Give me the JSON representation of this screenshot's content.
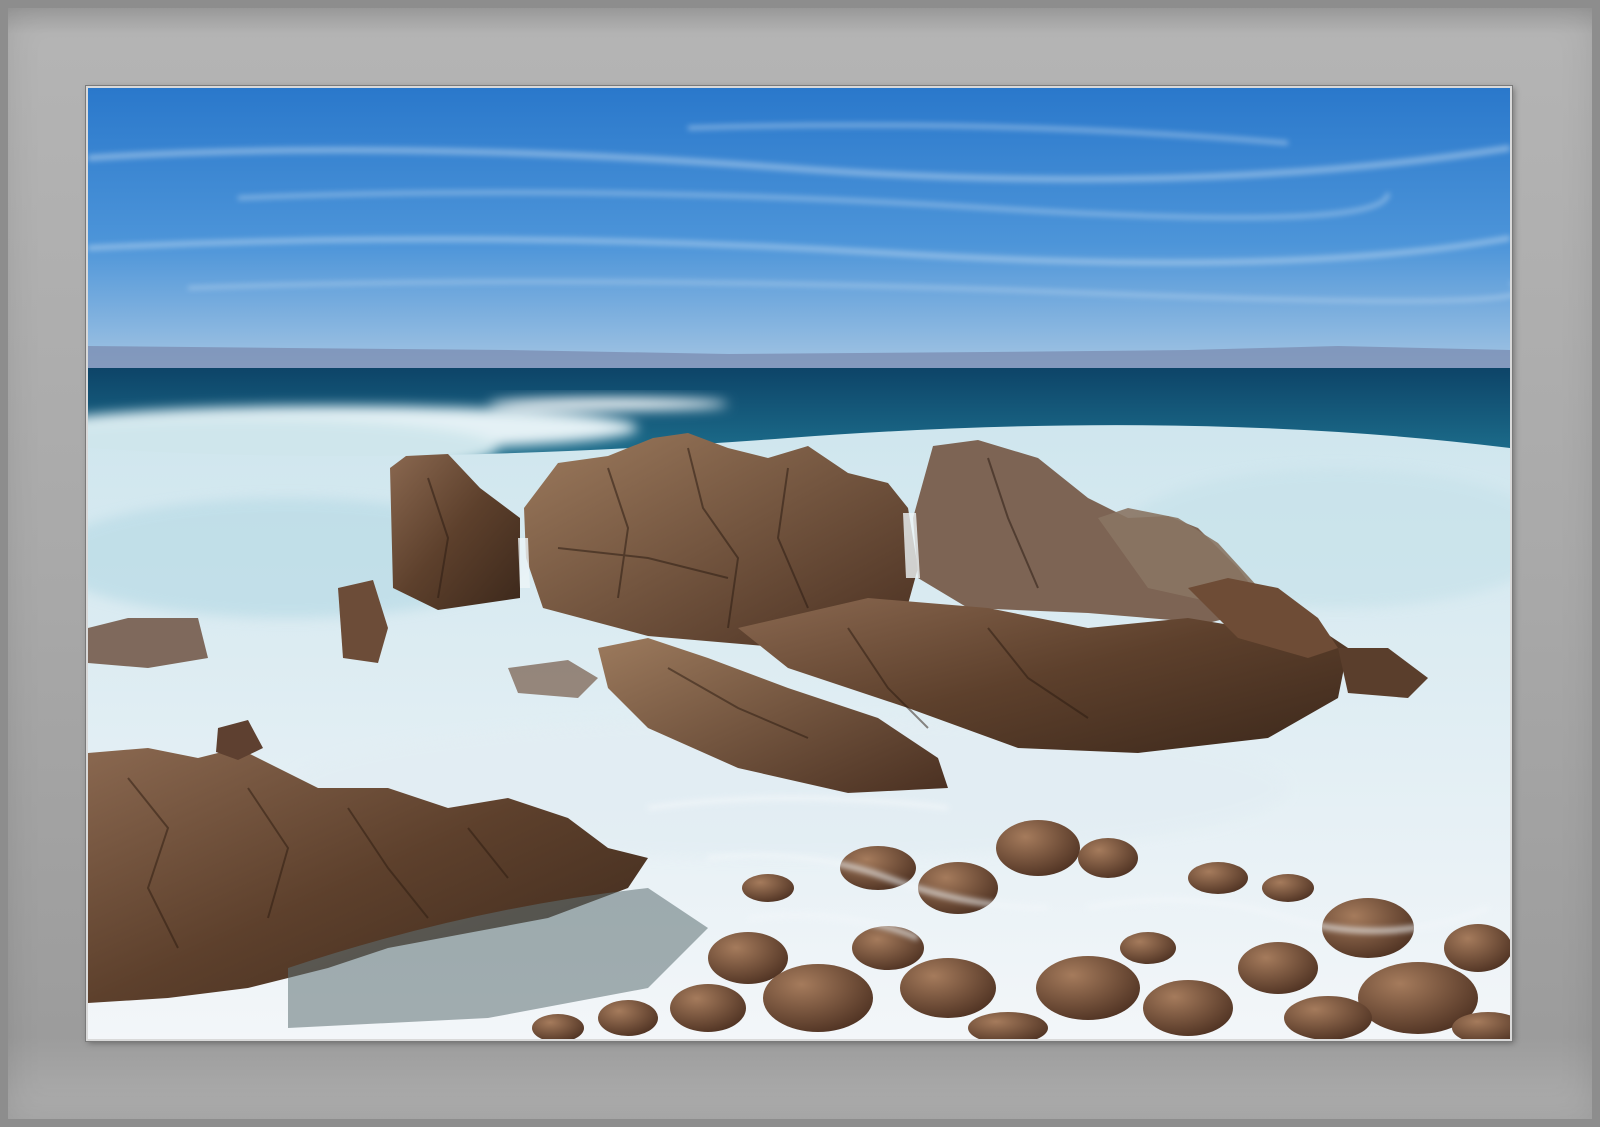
{
  "image": {
    "subject": "coastal-seascape",
    "colors": {
      "frame": "#a8a8a8",
      "sky_top": "#2f7fd0",
      "sky_bottom": "#9cc4e6",
      "ocean_deep": "#0f4f76",
      "surf": "#eef4f8",
      "rock": "#6b4a34"
    }
  }
}
